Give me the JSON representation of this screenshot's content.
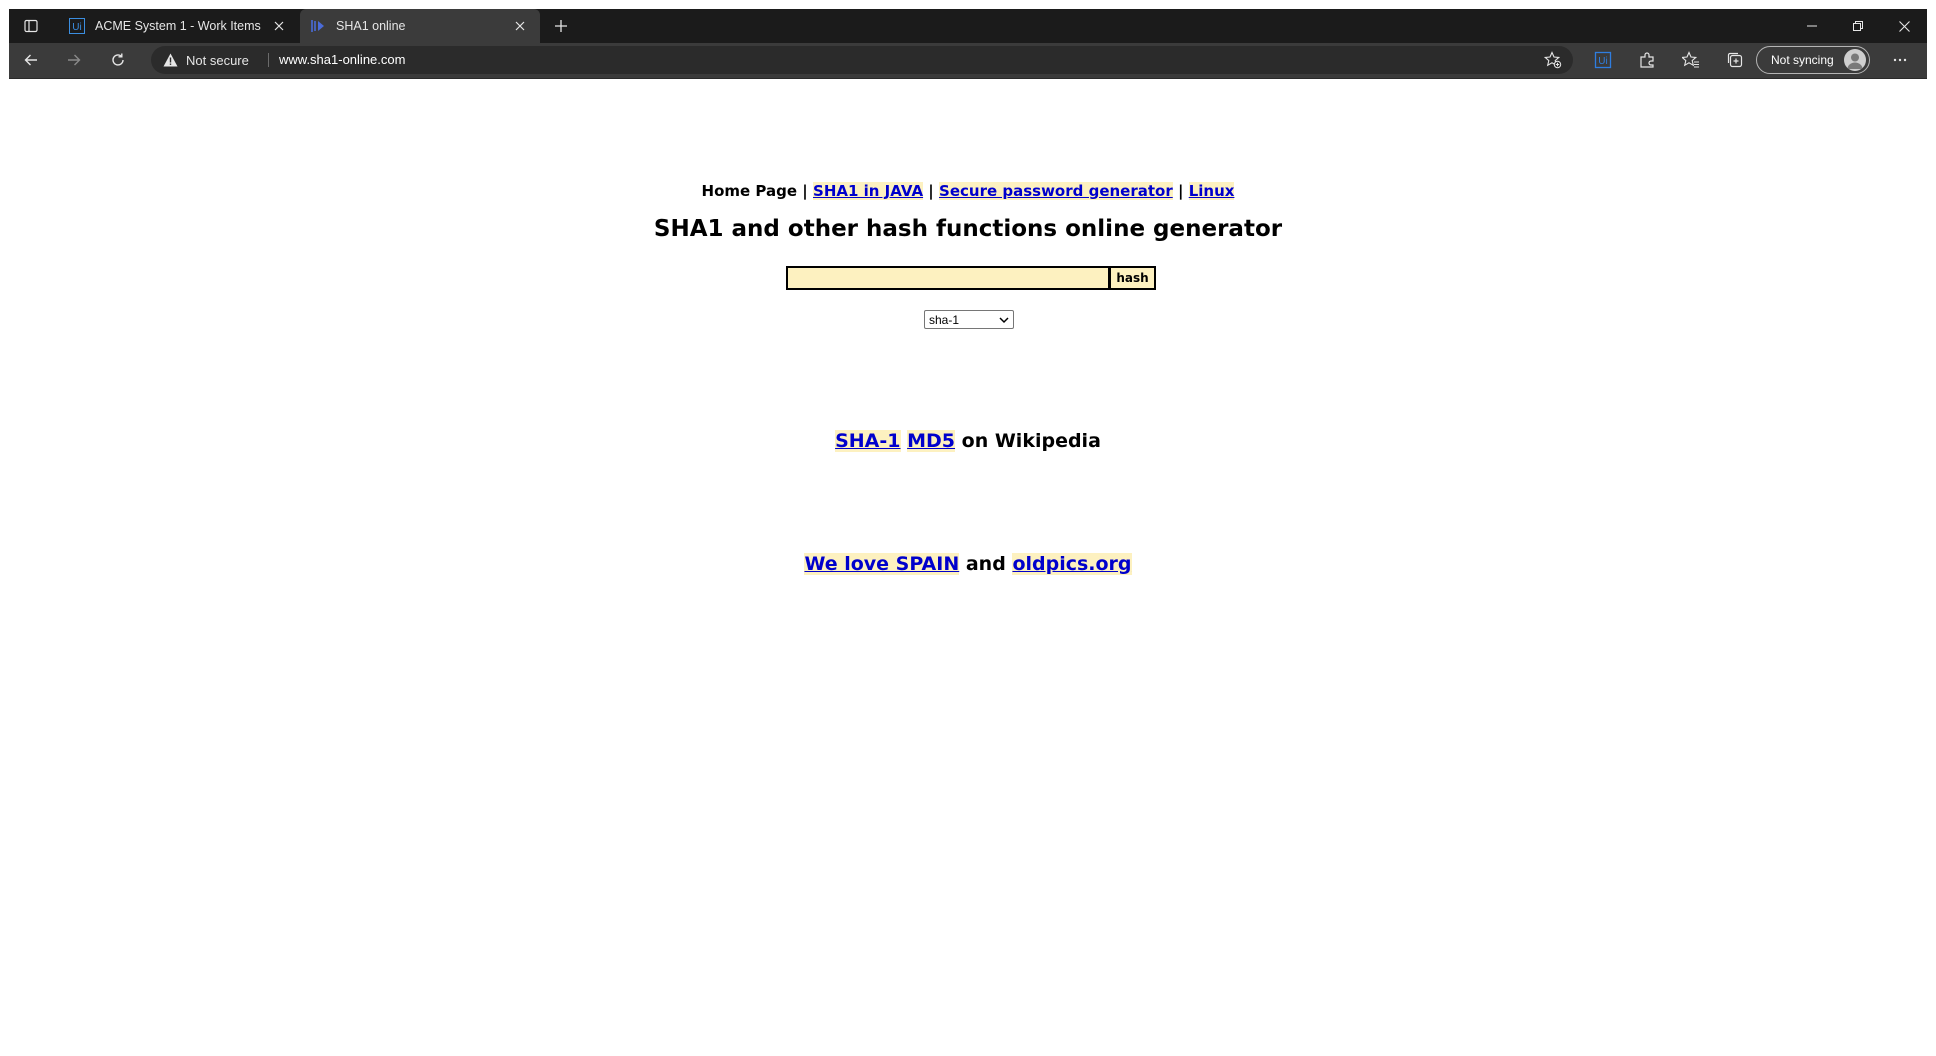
{
  "window": {
    "tabs": [
      {
        "title": "ACME System 1 - Work Items",
        "favicon": "uipath-ui-icon",
        "active": false
      },
      {
        "title": "SHA1 online",
        "favicon": "sha1-site-icon",
        "active": true
      }
    ],
    "controls": [
      "minimize-icon",
      "restore-icon",
      "close-icon"
    ]
  },
  "toolbar": {
    "security_label": "Not secure",
    "url": "www.sha1-online.com",
    "profile_label": "Not syncing",
    "icons": [
      "back-icon",
      "forward-icon",
      "refresh-icon",
      "add-favorite-icon",
      "uipath-extension-icon",
      "extensions-icon",
      "favorites-icon",
      "collections-icon",
      "more-icon"
    ]
  },
  "page": {
    "nav": {
      "home": "Home Page",
      "sep": "|",
      "links": [
        "SHA1 in JAVA",
        "Secure password generator",
        "Linux"
      ]
    },
    "headline": "SHA1 and other hash functions online generator",
    "form": {
      "input_value": "",
      "button_label": "hash",
      "algorithm_selected": "sha-1"
    },
    "wiki": {
      "link1": "SHA-1",
      "link2": "MD5",
      "suffix": "on Wikipedia"
    },
    "promo": {
      "link1": "We love SPAIN",
      "middle": "and",
      "link2": "oldpics.org"
    }
  },
  "colors": {
    "highlight": "#fdf1c0",
    "link": "#0000cc",
    "chrome_dark": "#1b1b1b",
    "chrome_toolbar": "#3b3b3b"
  }
}
